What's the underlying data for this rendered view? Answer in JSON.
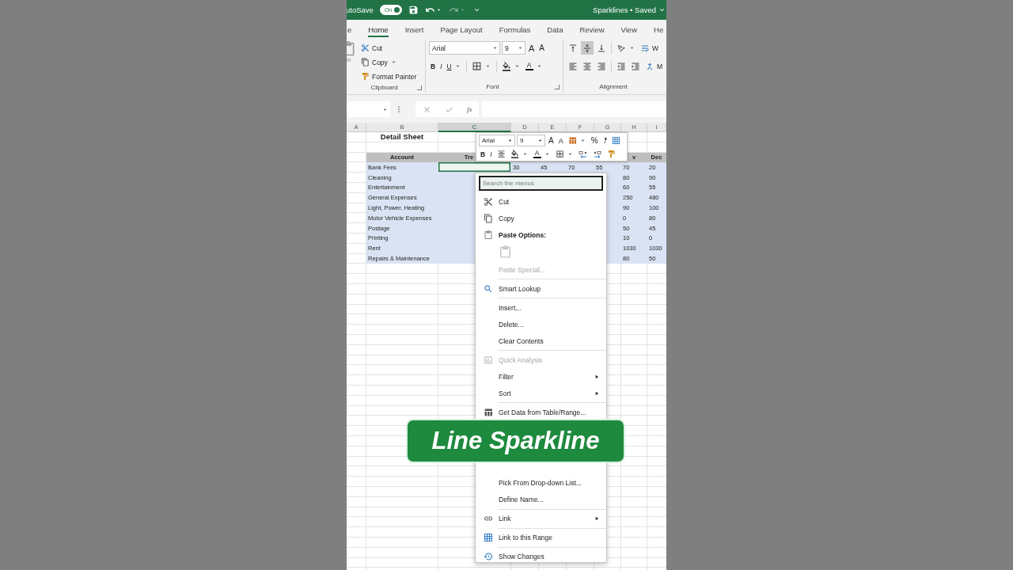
{
  "title_bar": {
    "autosave_label": "utoSave",
    "autosave_toggle": {
      "label": "On",
      "on": true
    },
    "redo_disabled": true,
    "document_title": "Sparklines • Saved"
  },
  "ribbon_tabs": [
    {
      "label": "e",
      "selected": false
    },
    {
      "label": "Home",
      "selected": true
    },
    {
      "label": "Insert",
      "selected": false
    },
    {
      "label": "Page Layout",
      "selected": false
    },
    {
      "label": "Formulas",
      "selected": false
    },
    {
      "label": "Data",
      "selected": false
    },
    {
      "label": "Review",
      "selected": false
    },
    {
      "label": "View",
      "selected": false
    },
    {
      "label": "He",
      "selected": false
    }
  ],
  "ribbon": {
    "clipboard": {
      "paste_label": "te",
      "cut": "Cut",
      "copy": "Copy",
      "format_painter": "Format Painter",
      "title": "Clipboard"
    },
    "font": {
      "font_name": "Arial",
      "font_size": "9",
      "grow_font": "A",
      "shrink_font": "A",
      "bold": "B",
      "italic": "I",
      "underline": "U",
      "font_color": "A",
      "title": "Font"
    },
    "alignment": {
      "vertical_align": [
        {
          "selected": false
        },
        {
          "selected": true
        },
        {
          "selected": false
        }
      ],
      "wrap_text": "W",
      "merge": "M",
      "title": "Alignment"
    }
  },
  "formula_bar": {
    "function_label": "fx"
  },
  "sheet": {
    "columns": [
      {
        "label": "A",
        "selected": false
      },
      {
        "label": "B",
        "selected": false
      },
      {
        "label": "C",
        "selected": true
      },
      {
        "label": "D",
        "selected": false
      },
      {
        "label": "E",
        "selected": false
      },
      {
        "label": "F",
        "selected": false
      },
      {
        "label": "G",
        "selected": false
      },
      {
        "label": "H",
        "selected": false
      },
      {
        "label": "I",
        "selected": false
      }
    ],
    "rows": [
      {
        "kind": "title",
        "selected": false,
        "cells": {
          "B": "Detail Sheet"
        }
      },
      {
        "kind": "blank",
        "selected": false
      },
      {
        "kind": "header",
        "selected": false,
        "cells": {
          "B": "Account",
          "C": "Tre",
          "H": "v",
          "I": "Dec"
        }
      },
      {
        "kind": "data",
        "selected": true,
        "cells": {
          "B": "Bank Fees",
          "D": "30",
          "E": "45",
          "F": "70",
          "G": "55",
          "H": "70",
          "I": "20"
        }
      },
      {
        "kind": "data",
        "selected": false,
        "cells": {
          "B": "Cleaning",
          "H": "80",
          "I": "90"
        }
      },
      {
        "kind": "data",
        "selected": false,
        "cells": {
          "B": "Entertainment",
          "H": "60",
          "I": "55"
        }
      },
      {
        "kind": "data",
        "selected": false,
        "cells": {
          "B": "General Expenses",
          "H": "250",
          "I": "480"
        }
      },
      {
        "kind": "data",
        "selected": false,
        "cells": {
          "B": "Light, Power, Heating",
          "H": "90",
          "I": "100"
        }
      },
      {
        "kind": "data",
        "selected": false,
        "cells": {
          "B": "Motor Vehicle Expenses",
          "H": "0",
          "I": "80"
        }
      },
      {
        "kind": "data",
        "selected": false,
        "cells": {
          "B": "Postage",
          "H": "50",
          "I": "45"
        }
      },
      {
        "kind": "data",
        "selected": false,
        "cells": {
          "B": "Printing",
          "H": "10",
          "I": "0"
        }
      },
      {
        "kind": "data",
        "selected": false,
        "cells": {
          "B": "Rent",
          "H": "1030",
          "I": "1030"
        }
      },
      {
        "kind": "data",
        "selected": false,
        "cells": {
          "B": "Repairs & Maintenance",
          "H": "80",
          "I": "50"
        }
      }
    ]
  },
  "mini_toolbar": {
    "font_name": "Arial",
    "font_size": "9",
    "grow_font": "A",
    "shrink_font": "A",
    "percent": "%",
    "bold": "B",
    "italic": "I",
    "font_color": "A"
  },
  "context_menu": {
    "search_placeholder": "Search the menus",
    "groups_above_banner": [
      [
        {
          "kind": "item",
          "label": "Cut",
          "disabled": false,
          "submenu": false
        },
        {
          "kind": "item",
          "label": "Copy",
          "disabled": false,
          "submenu": false
        },
        {
          "kind": "heading",
          "label": "Paste Options:"
        },
        {
          "kind": "paste-choice",
          "disabled": true
        },
        {
          "kind": "item",
          "label": "Paste Special...",
          "disabled": true,
          "submenu": false
        }
      ],
      [
        {
          "kind": "item",
          "label": "Smart Lookup",
          "disabled": false,
          "submenu": false
        }
      ],
      [
        {
          "kind": "item",
          "label": "Insert...",
          "disabled": false,
          "submenu": false
        },
        {
          "kind": "item",
          "label": "Delete...",
          "disabled": false,
          "submenu": false
        },
        {
          "kind": "item",
          "label": "Clear Contents",
          "disabled": false,
          "submenu": false
        }
      ],
      [
        {
          "kind": "item",
          "label": "Quick Analysis",
          "disabled": true,
          "submenu": false
        },
        {
          "kind": "item",
          "label": "Filter",
          "disabled": false,
          "submenu": true
        },
        {
          "kind": "item",
          "label": "Sort",
          "disabled": false,
          "submenu": true
        }
      ],
      [
        {
          "kind": "item",
          "label": "Get Data from Table/Range...",
          "disabled": false,
          "submenu": false
        }
      ]
    ],
    "groups_below_banner": [
      [
        {
          "kind": "item",
          "label": "Pick From Drop-down List...",
          "disabled": false,
          "submenu": false
        },
        {
          "kind": "item",
          "label": "Define Name...",
          "disabled": false,
          "submenu": false
        }
      ],
      [
        {
          "kind": "item",
          "label": "Link",
          "disabled": false,
          "submenu": true
        }
      ],
      [
        {
          "kind": "item",
          "label": "Link to this Range",
          "disabled": false,
          "submenu": false
        }
      ],
      [
        {
          "kind": "item",
          "label": "Show Changes",
          "disabled": false,
          "submenu": false
        }
      ]
    ]
  },
  "banner": {
    "text": "Line Sparkline"
  }
}
